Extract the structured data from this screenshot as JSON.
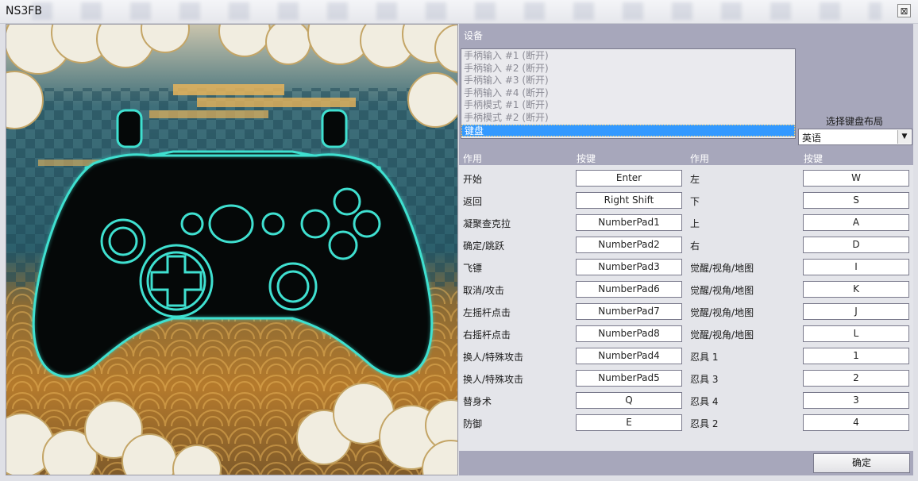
{
  "window": {
    "title": "NS3FB",
    "close_glyph": "⊠"
  },
  "devices": {
    "label": "设备",
    "items": [
      "手柄输入 #1 (断开)",
      "手柄输入 #2 (断开)",
      "手柄输入 #3 (断开)",
      "手柄输入 #4 (断开)",
      "手柄模式 #1 (断开)",
      "手柄模式 #2 (断开)",
      "键盘"
    ],
    "selected_index": 6
  },
  "keyboard_layout": {
    "label": "选择键盘布局",
    "value": "英语"
  },
  "columns": {
    "action1": "作用",
    "key1": "按键",
    "action2": "作用",
    "key2": "按键"
  },
  "bindings": [
    {
      "a1": "开始",
      "k1": "Enter",
      "a2": "左",
      "k2": "W"
    },
    {
      "a1": "返回",
      "k1": "Right Shift",
      "a2": "下",
      "k2": "S"
    },
    {
      "a1": "凝聚查克拉",
      "k1": "NumberPad1",
      "a2": "上",
      "k2": "A"
    },
    {
      "a1": "确定/跳跃",
      "k1": "NumberPad2",
      "a2": "右",
      "k2": "D"
    },
    {
      "a1": "飞镖",
      "k1": "NumberPad3",
      "a2": "觉醒/视角/地图",
      "k2": "I"
    },
    {
      "a1": "取消/攻击",
      "k1": "NumberPad6",
      "a2": "觉醒/视角/地图",
      "k2": "K"
    },
    {
      "a1": "左摇杆点击",
      "k1": "NumberPad7",
      "a2": "觉醒/视角/地图",
      "k2": "J"
    },
    {
      "a1": "右摇杆点击",
      "k1": "NumberPad8",
      "a2": "觉醒/视角/地图",
      "k2": "L"
    },
    {
      "a1": "换人/特殊攻击",
      "k1": "NumberPad4",
      "a2": "忍具 1",
      "k2": "1"
    },
    {
      "a1": "换人/特殊攻击",
      "k1": "NumberPad5",
      "a2": "忍具 3",
      "k2": "2"
    },
    {
      "a1": "替身术",
      "k1": "Q",
      "a2": "忍具 4",
      "k2": "3"
    },
    {
      "a1": "防御",
      "k1": "E",
      "a2": "忍具 2",
      "k2": "4"
    }
  ],
  "ok_label": "确定",
  "colors": {
    "accent": "#3399ff",
    "band": "#a7a7bb",
    "glow": "#3fe0d0"
  },
  "icons": {
    "controller": "gamepad-icon",
    "dropdown": "chevron-down-icon",
    "close": "close-icon"
  }
}
